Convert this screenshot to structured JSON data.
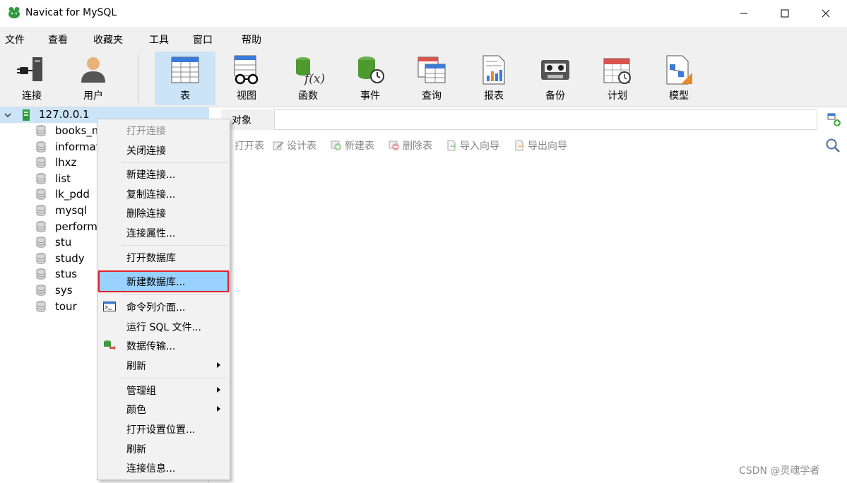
{
  "window": {
    "title": "Navicat for MySQL"
  },
  "menubar": {
    "items": [
      "文件",
      "查看",
      "收藏夹",
      "工具",
      "窗口",
      "帮助"
    ]
  },
  "toolbar": {
    "items": [
      "连接",
      "用户",
      "表",
      "视图",
      "函数",
      "事件",
      "查询",
      "报表",
      "备份",
      "计划",
      "模型"
    ],
    "active": "表"
  },
  "tree": {
    "connection": "127.0.0.1",
    "databases": [
      "books_m",
      "informat",
      "lhxz",
      "list",
      "lk_pdd",
      "mysql",
      "perform",
      "stu",
      "study",
      "stus",
      "sys",
      "tour"
    ]
  },
  "objects": {
    "tab_label": "对象",
    "tools": [
      "打开表",
      "设计表",
      "新建表",
      "删除表",
      "导入向导",
      "导出向导"
    ]
  },
  "context_menu": {
    "items": [
      "打开连接",
      "关闭连接",
      "新建连接...",
      "复制连接...",
      "删除连接",
      "连接属性...",
      "打开数据库",
      "新建数据库...",
      "命令列介面...",
      "运行 SQL 文件...",
      "数据传输...",
      "刷新",
      "管理组",
      "颜色",
      "打开设置位置...",
      "刷新",
      "连接信息..."
    ],
    "disabled": "打开连接",
    "highlighted": "新建数据库..."
  },
  "watermark": "CSDN @灵魂学者",
  "colors": {
    "selection": "#cce4f7",
    "menu_highlight": "#99d1ff",
    "annotation_box": "#e3212b"
  }
}
